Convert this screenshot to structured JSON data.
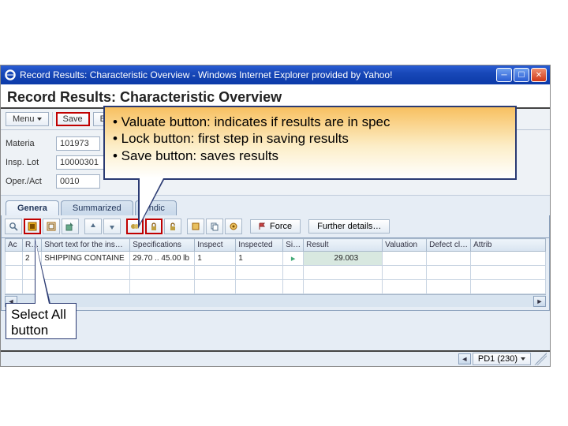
{
  "window": {
    "title": "Record Results: Characteristic Overview - Windows Internet Explorer provided by Yahoo!"
  },
  "app": {
    "title": "Record Results: Characteristic Overview"
  },
  "toolbar": {
    "menu": "Menu",
    "save": "Save",
    "back": "Bac"
  },
  "form": {
    "material_label": "Materia",
    "material_value": "101973",
    "insplot_label": "Insp. Lot",
    "insplot_value": "10000301",
    "oper_label": "Oper./Act",
    "oper_value": "0010"
  },
  "tabs": {
    "general": "Genera",
    "summarized": "Summarized",
    "indic": "Indic"
  },
  "actions": {
    "force": "Force",
    "further": "Further details…"
  },
  "table": {
    "headers": {
      "ac": "Ac",
      "r": "R…",
      "short": "Short text for the ins…",
      "spec": "Specifications",
      "inspect": "Inspect",
      "inspected": "Inspected",
      "si": "Si…",
      "result": "Result",
      "valuation": "Valuation",
      "defect": "Defect cl…",
      "attrib": "Attrib"
    },
    "rows": [
      {
        "r": "2",
        "short": "SHIPPING CONTAINE",
        "spec": "29.70 .. 45.00 lb",
        "inspect": "1",
        "inspected": "1",
        "result": "29.003"
      }
    ]
  },
  "status": {
    "system": "PD1 (230)"
  },
  "callout_large": {
    "line1": "• Valuate button:  indicates if results are in spec",
    "line2": "• Lock button:  first step in saving results",
    "line3": "• Save button:  saves results"
  },
  "callout_small": {
    "line1": "Select All",
    "line2": "button"
  },
  "icons": {
    "search": "search-icon",
    "selectall": "select-all-icon",
    "deselectall": "deselect-all-icon",
    "export": "export-icon",
    "valuate": "valuate-icon",
    "lock": "lock-icon",
    "unlock": "unlock-icon",
    "detail1": "detail-icon",
    "detail2": "copy-icon",
    "detail3": "sample-icon"
  }
}
